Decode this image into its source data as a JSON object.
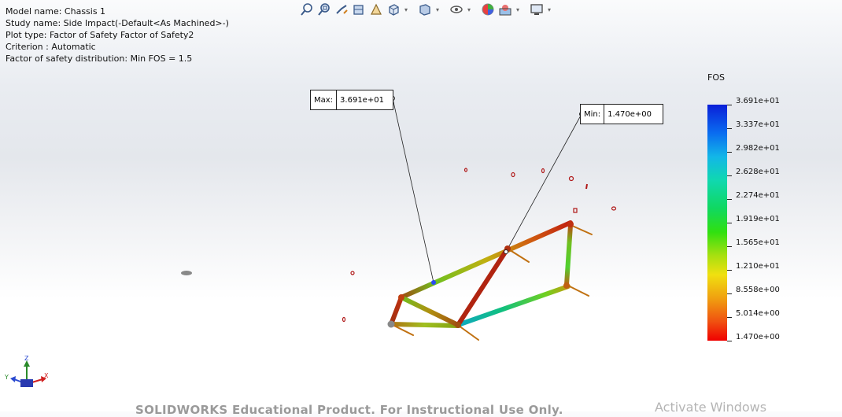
{
  "info": {
    "model_name": "Model name: Chassis 1",
    "study_name": "Study name: Side Impact(-Default<As Machined>-)",
    "plot_type": "Plot type: Factor of Safety Factor of Safety2",
    "criterion": "Criterion : Automatic",
    "fos_distribution": "Factor of safety distribution: Min FOS = 1.5"
  },
  "toolbar": {
    "items": [
      "zoom-to-fit-icon",
      "zoom-to-area-icon",
      "previous-view-icon",
      "section-view-icon",
      "dynamic-annotation-icon",
      "view-orientation-icon",
      "display-style-icon",
      "hide-show-items-icon",
      "edit-appearance-icon",
      "apply-scene-icon",
      "view-settings-icon"
    ]
  },
  "callouts": {
    "max_label": "Max:",
    "max_value": "3.691e+01",
    "min_label": "Min:",
    "min_value": "1.470e+00"
  },
  "legend": {
    "title": "FOS",
    "labels": [
      "3.691e+01",
      "3.337e+01",
      "2.982e+01",
      "2.628e+01",
      "2.274e+01",
      "1.919e+01",
      "1.565e+01",
      "1.210e+01",
      "8.558e+00",
      "5.014e+00",
      "1.470e+00"
    ],
    "colors": {
      "top": "#0a1fd8",
      "bottom": "#f00000"
    }
  },
  "axis": {
    "z_label": "Z",
    "y_label": "Y",
    "x_label": "X"
  },
  "watermark": {
    "solidworks": "SOLIDWORKS Educational Product. For Instructional Use Only.",
    "activate": "Activate Windows"
  }
}
